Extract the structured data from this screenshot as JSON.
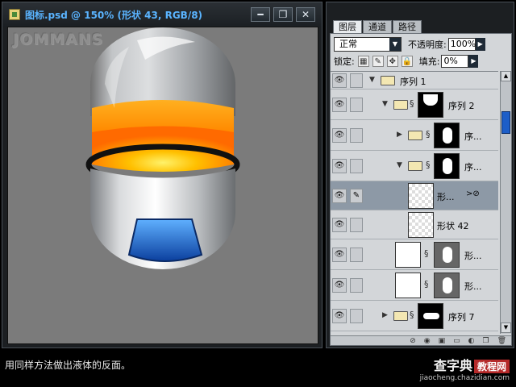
{
  "document": {
    "title": "图标.psd @ 150% (形状 43, RGB/8)",
    "buttons": {
      "minimize": "━",
      "restore": "❐",
      "close": "✕"
    },
    "watermark": "JOMMANS"
  },
  "layers_panel": {
    "tabs": [
      "图层",
      "通道",
      "路径"
    ],
    "blend_mode": "正常",
    "opacity_label": "不透明度:",
    "opacity_value": "100%",
    "lock_label": "锁定:",
    "fill_label": "填充:",
    "fill_value": "0%",
    "layers": [
      {
        "name": "序列 1",
        "type": "group"
      },
      {
        "name": "序列 2",
        "type": "group"
      },
      {
        "name": "序...",
        "type": "group"
      },
      {
        "name": "序...",
        "type": "group"
      },
      {
        "name": "形...",
        "type": "shape",
        "selected": true
      },
      {
        "name": "形状 42",
        "type": "shape"
      },
      {
        "name": "形...",
        "type": "adjustment"
      },
      {
        "name": "形...",
        "type": "adjustment"
      },
      {
        "name": "序列 7",
        "type": "group"
      }
    ]
  },
  "caption": "用同样方法做出液体的反面。",
  "site": {
    "brand": "查字典",
    "tag": "教程网",
    "url": "jiaocheng.chazidian.com"
  },
  "colors": {
    "liquid_orange": "#ff9a00",
    "cap_blue": "#1f6fe0",
    "title_blue": "#5ab4ff",
    "selected_layer": "#8d99a6"
  }
}
